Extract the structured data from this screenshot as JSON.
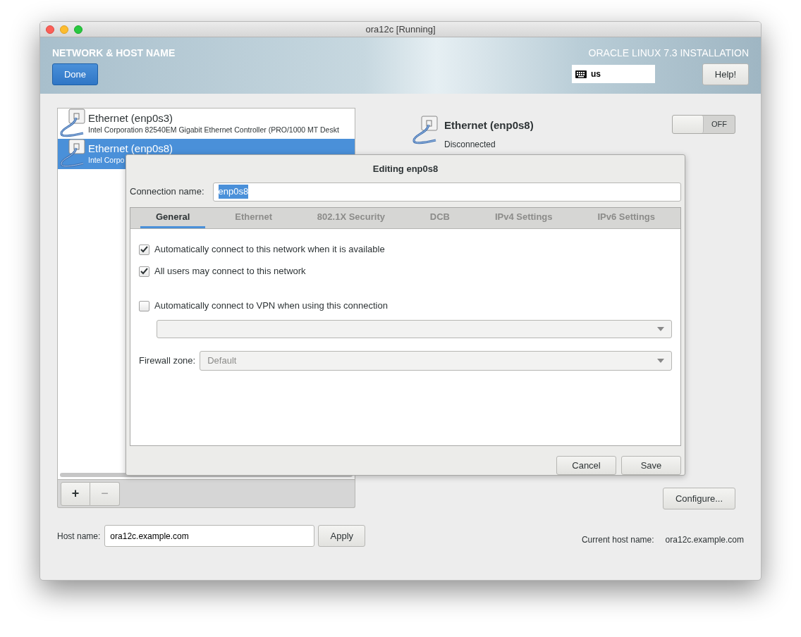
{
  "window": {
    "title": "ora12c [Running]"
  },
  "header": {
    "title": "NETWORK & HOST NAME",
    "done_button": "Done",
    "product": "ORACLE LINUX 7.3 INSTALLATION",
    "keyboard_layout": "us",
    "help_button": "Help!"
  },
  "devices": [
    {
      "name": "Ethernet (enp0s3)",
      "description": "Intel Corporation 82540EM Gigabit Ethernet Controller (PRO/1000 MT Deskt",
      "selected": false
    },
    {
      "name": "Ethernet (enp0s8)",
      "description": "Intel Corpo",
      "selected": true
    }
  ],
  "list_toolbar": {
    "add_button": "+",
    "remove_button": "−"
  },
  "device_detail": {
    "name": "Ethernet (enp0s8)",
    "status": "Disconnected",
    "toggle": {
      "label": "OFF",
      "on": false
    },
    "configure_button": "Configure..."
  },
  "hostname": {
    "label": "Host name:",
    "value": "ora12c.example.com",
    "apply_button": "Apply",
    "current_label": "Current host name:",
    "current_value": "ora12c.example.com"
  },
  "dialog": {
    "title": "Editing enp0s8",
    "connection_name_label": "Connection name:",
    "connection_name": "enp0s8",
    "connection_name_selected": true,
    "tabs": [
      {
        "label": "General",
        "selected": true
      },
      {
        "label": "Ethernet",
        "selected": false
      },
      {
        "label": "802.1X Security",
        "selected": false
      },
      {
        "label": "DCB",
        "selected": false
      },
      {
        "label": "IPv4 Settings",
        "selected": false
      },
      {
        "label": "IPv6 Settings",
        "selected": false
      }
    ],
    "options": [
      {
        "kind": "checkbox",
        "label": "Automatically connect to this network when it is available",
        "checked": true
      },
      {
        "kind": "checkbox",
        "label": "All users may connect to this network",
        "checked": true
      },
      {
        "kind": "checkbox",
        "label": "Automatically connect to VPN when using this connection",
        "checked": false
      },
      {
        "kind": "dropdown"
      },
      {
        "kind": "labeled_dropdown",
        "label": "Firewall zone:",
        "value": "Default",
        "disabled": true
      }
    ],
    "buttons": [
      "Cancel",
      "Save"
    ]
  }
}
